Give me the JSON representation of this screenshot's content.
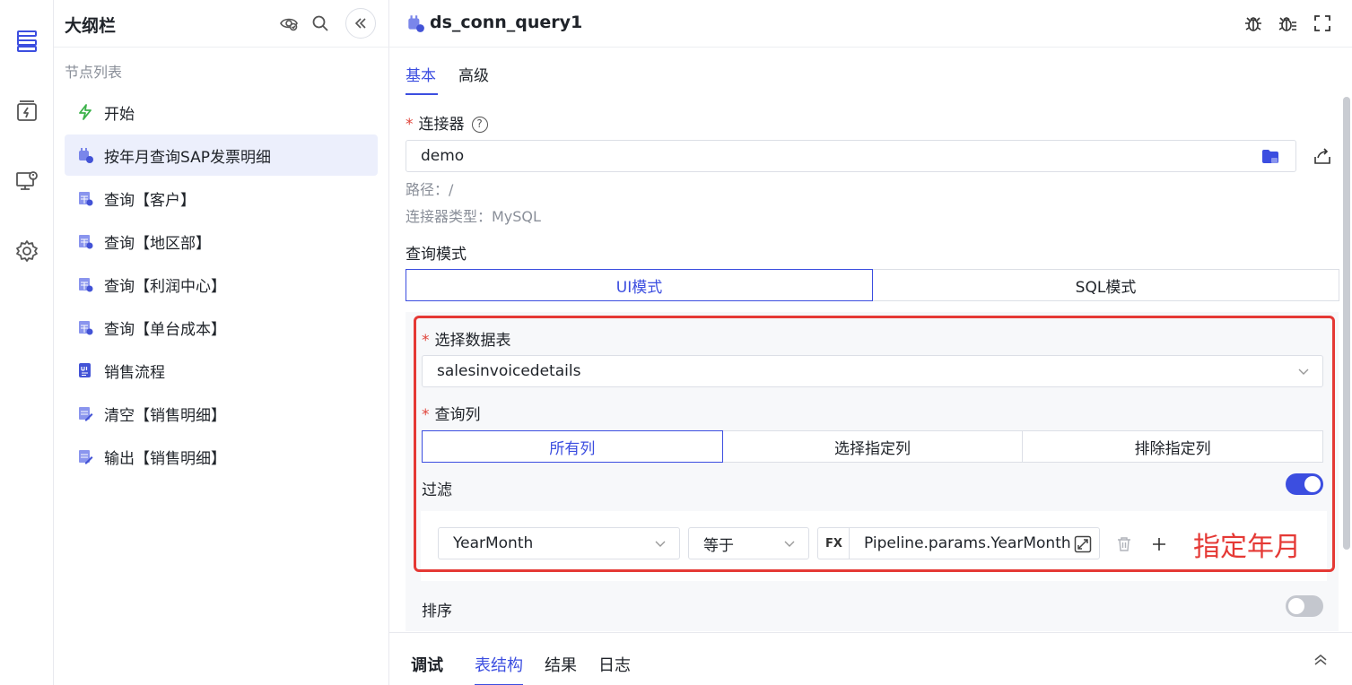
{
  "outline": {
    "title": "大纲栏",
    "node_list_label": "节点列表",
    "nodes": [
      {
        "label": "开始",
        "icon": "lightning-icon"
      },
      {
        "label": "按年月查询SAP发票明细",
        "icon": "plug-icon",
        "active": true
      },
      {
        "label": "查询【客户】",
        "icon": "table-query-icon"
      },
      {
        "label": "查询【地区部】",
        "icon": "table-query-icon"
      },
      {
        "label": "查询【利润中心】",
        "icon": "table-query-icon"
      },
      {
        "label": "查询【单台成本】",
        "icon": "table-query-icon"
      },
      {
        "label": "销售流程",
        "icon": "ui-doc-icon"
      },
      {
        "label": "清空【销售明细】",
        "icon": "table-edit-icon"
      },
      {
        "label": "输出【销售明细】",
        "icon": "table-edit-icon"
      }
    ]
  },
  "main": {
    "node_title": "ds_conn_query1",
    "tabs": [
      "基本",
      "高级"
    ],
    "connector": {
      "label": "连接器",
      "value": "demo",
      "path": "路径：/",
      "type": "连接器类型：MySQL"
    },
    "query_mode": {
      "label": "查询模式",
      "options": [
        "UI模式",
        "SQL模式"
      ],
      "selected": 0
    },
    "table_select": {
      "label": "选择数据表",
      "value": "salesinvoicedetails"
    },
    "query_columns": {
      "label": "查询列",
      "options": [
        "所有列",
        "选择指定列",
        "排除指定列"
      ],
      "selected": 0
    },
    "filter": {
      "label": "过滤",
      "enabled": true,
      "field": "YearMonth",
      "operator": "等于",
      "fx_label": "FX",
      "value": "Pipeline.params.YearMonth",
      "annotation": "指定年月"
    },
    "sort": {
      "label": "排序",
      "enabled": false
    },
    "bottom_tabs": {
      "section": "调试",
      "tabs": [
        "表结构",
        "结果",
        "日志"
      ],
      "active": 0
    }
  },
  "colors": {
    "accent": "#3c4ee0",
    "annotation_red": "#e53935",
    "required_red": "#e0443a"
  }
}
